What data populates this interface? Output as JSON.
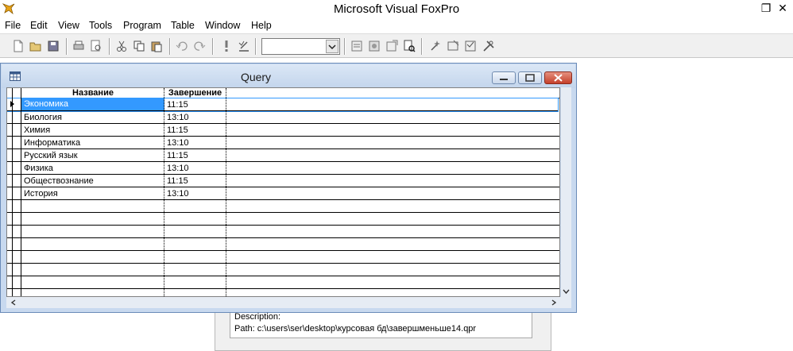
{
  "app": {
    "title": "Microsoft Visual FoxPro",
    "restore_glyph": "❐",
    "close_glyph": "✕"
  },
  "menu": {
    "items": [
      {
        "label": "File"
      },
      {
        "label": "Edit"
      },
      {
        "label": "View"
      },
      {
        "label": "Tools"
      },
      {
        "label": "Program"
      },
      {
        "label": "Table"
      },
      {
        "label": "Window"
      },
      {
        "label": "Help"
      }
    ]
  },
  "toolbar": {
    "combo_value": ""
  },
  "query_window": {
    "title": "Query",
    "columns": [
      {
        "label": "Название"
      },
      {
        "label": "Завершение"
      }
    ],
    "rows": [
      {
        "name": "Экономика",
        "end": "11:15",
        "selected": true
      },
      {
        "name": "Биология",
        "end": "13:10"
      },
      {
        "name": "Химия",
        "end": "11:15"
      },
      {
        "name": "Информатика",
        "end": "13:10"
      },
      {
        "name": "Русский язык",
        "end": "11:15"
      },
      {
        "name": "Физика",
        "end": "13:10"
      },
      {
        "name": "Обществознание",
        "end": "11:15"
      },
      {
        "name": "История",
        "end": "13:10"
      }
    ],
    "empty_rows": 8
  },
  "background_dialog": {
    "description_label": "Description:",
    "path_label": "Path: c:\\users\\ser\\desktop\\курсовая бд\\завершменьше14.qpr"
  },
  "colors": {
    "selection": "#3399ff",
    "window_frame": "#c8d9ef",
    "close_button": "#c4402b"
  }
}
